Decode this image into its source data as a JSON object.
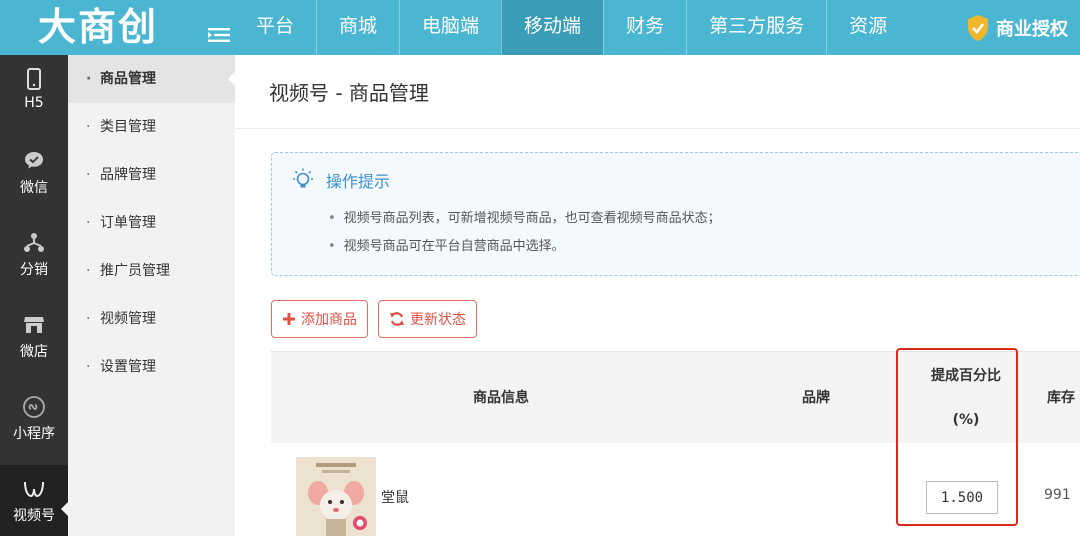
{
  "brand": {
    "logo": "大商创"
  },
  "topnav": {
    "items": [
      {
        "label": "平台",
        "active": false
      },
      {
        "label": "商城",
        "active": false
      },
      {
        "label": "电脑端",
        "active": false
      },
      {
        "label": "移动端",
        "active": true
      },
      {
        "label": "财务",
        "active": false
      },
      {
        "label": "第三方服务",
        "active": false
      },
      {
        "label": "资源",
        "active": false
      }
    ],
    "auth_label": "商业授权"
  },
  "rail": {
    "items": [
      {
        "label": "H5",
        "icon": "phone-icon"
      },
      {
        "label": "微信",
        "icon": "wechat-icon"
      },
      {
        "label": "分销",
        "icon": "distribution-icon"
      },
      {
        "label": "微店",
        "icon": "shop-icon"
      },
      {
        "label": "小程序",
        "icon": "miniprogram-icon"
      },
      {
        "label": "视频号",
        "icon": "channels-icon"
      }
    ]
  },
  "subnav": {
    "items": [
      {
        "label": "商品管理",
        "active": true
      },
      {
        "label": "类目管理"
      },
      {
        "label": "品牌管理"
      },
      {
        "label": "订单管理"
      },
      {
        "label": "推广员管理"
      },
      {
        "label": "视频管理"
      },
      {
        "label": "设置管理"
      }
    ]
  },
  "main": {
    "title": "视频号 - 商品管理",
    "tips": {
      "heading": "操作提示",
      "lines": [
        "视频号商品列表，可新增视频号商品，也可查看视频号商品状态；",
        "视频号商品可在平台自营商品中选择。"
      ]
    },
    "buttons": {
      "add": "添加商品",
      "refresh": "更新状态"
    },
    "table": {
      "headers": {
        "info": "商品信息",
        "brand": "品牌",
        "commission_1": "提成百分比",
        "commission_2": "(%)",
        "stock": "库存"
      },
      "rows": [
        {
          "name": "堂鼠",
          "commission": "1.500",
          "stock": "991"
        }
      ]
    }
  },
  "colors": {
    "topbar": "#4ab6d2",
    "accent_red": "#e05145",
    "highlight": "#d92a1c",
    "tip_blue": "#3e8fd0"
  }
}
